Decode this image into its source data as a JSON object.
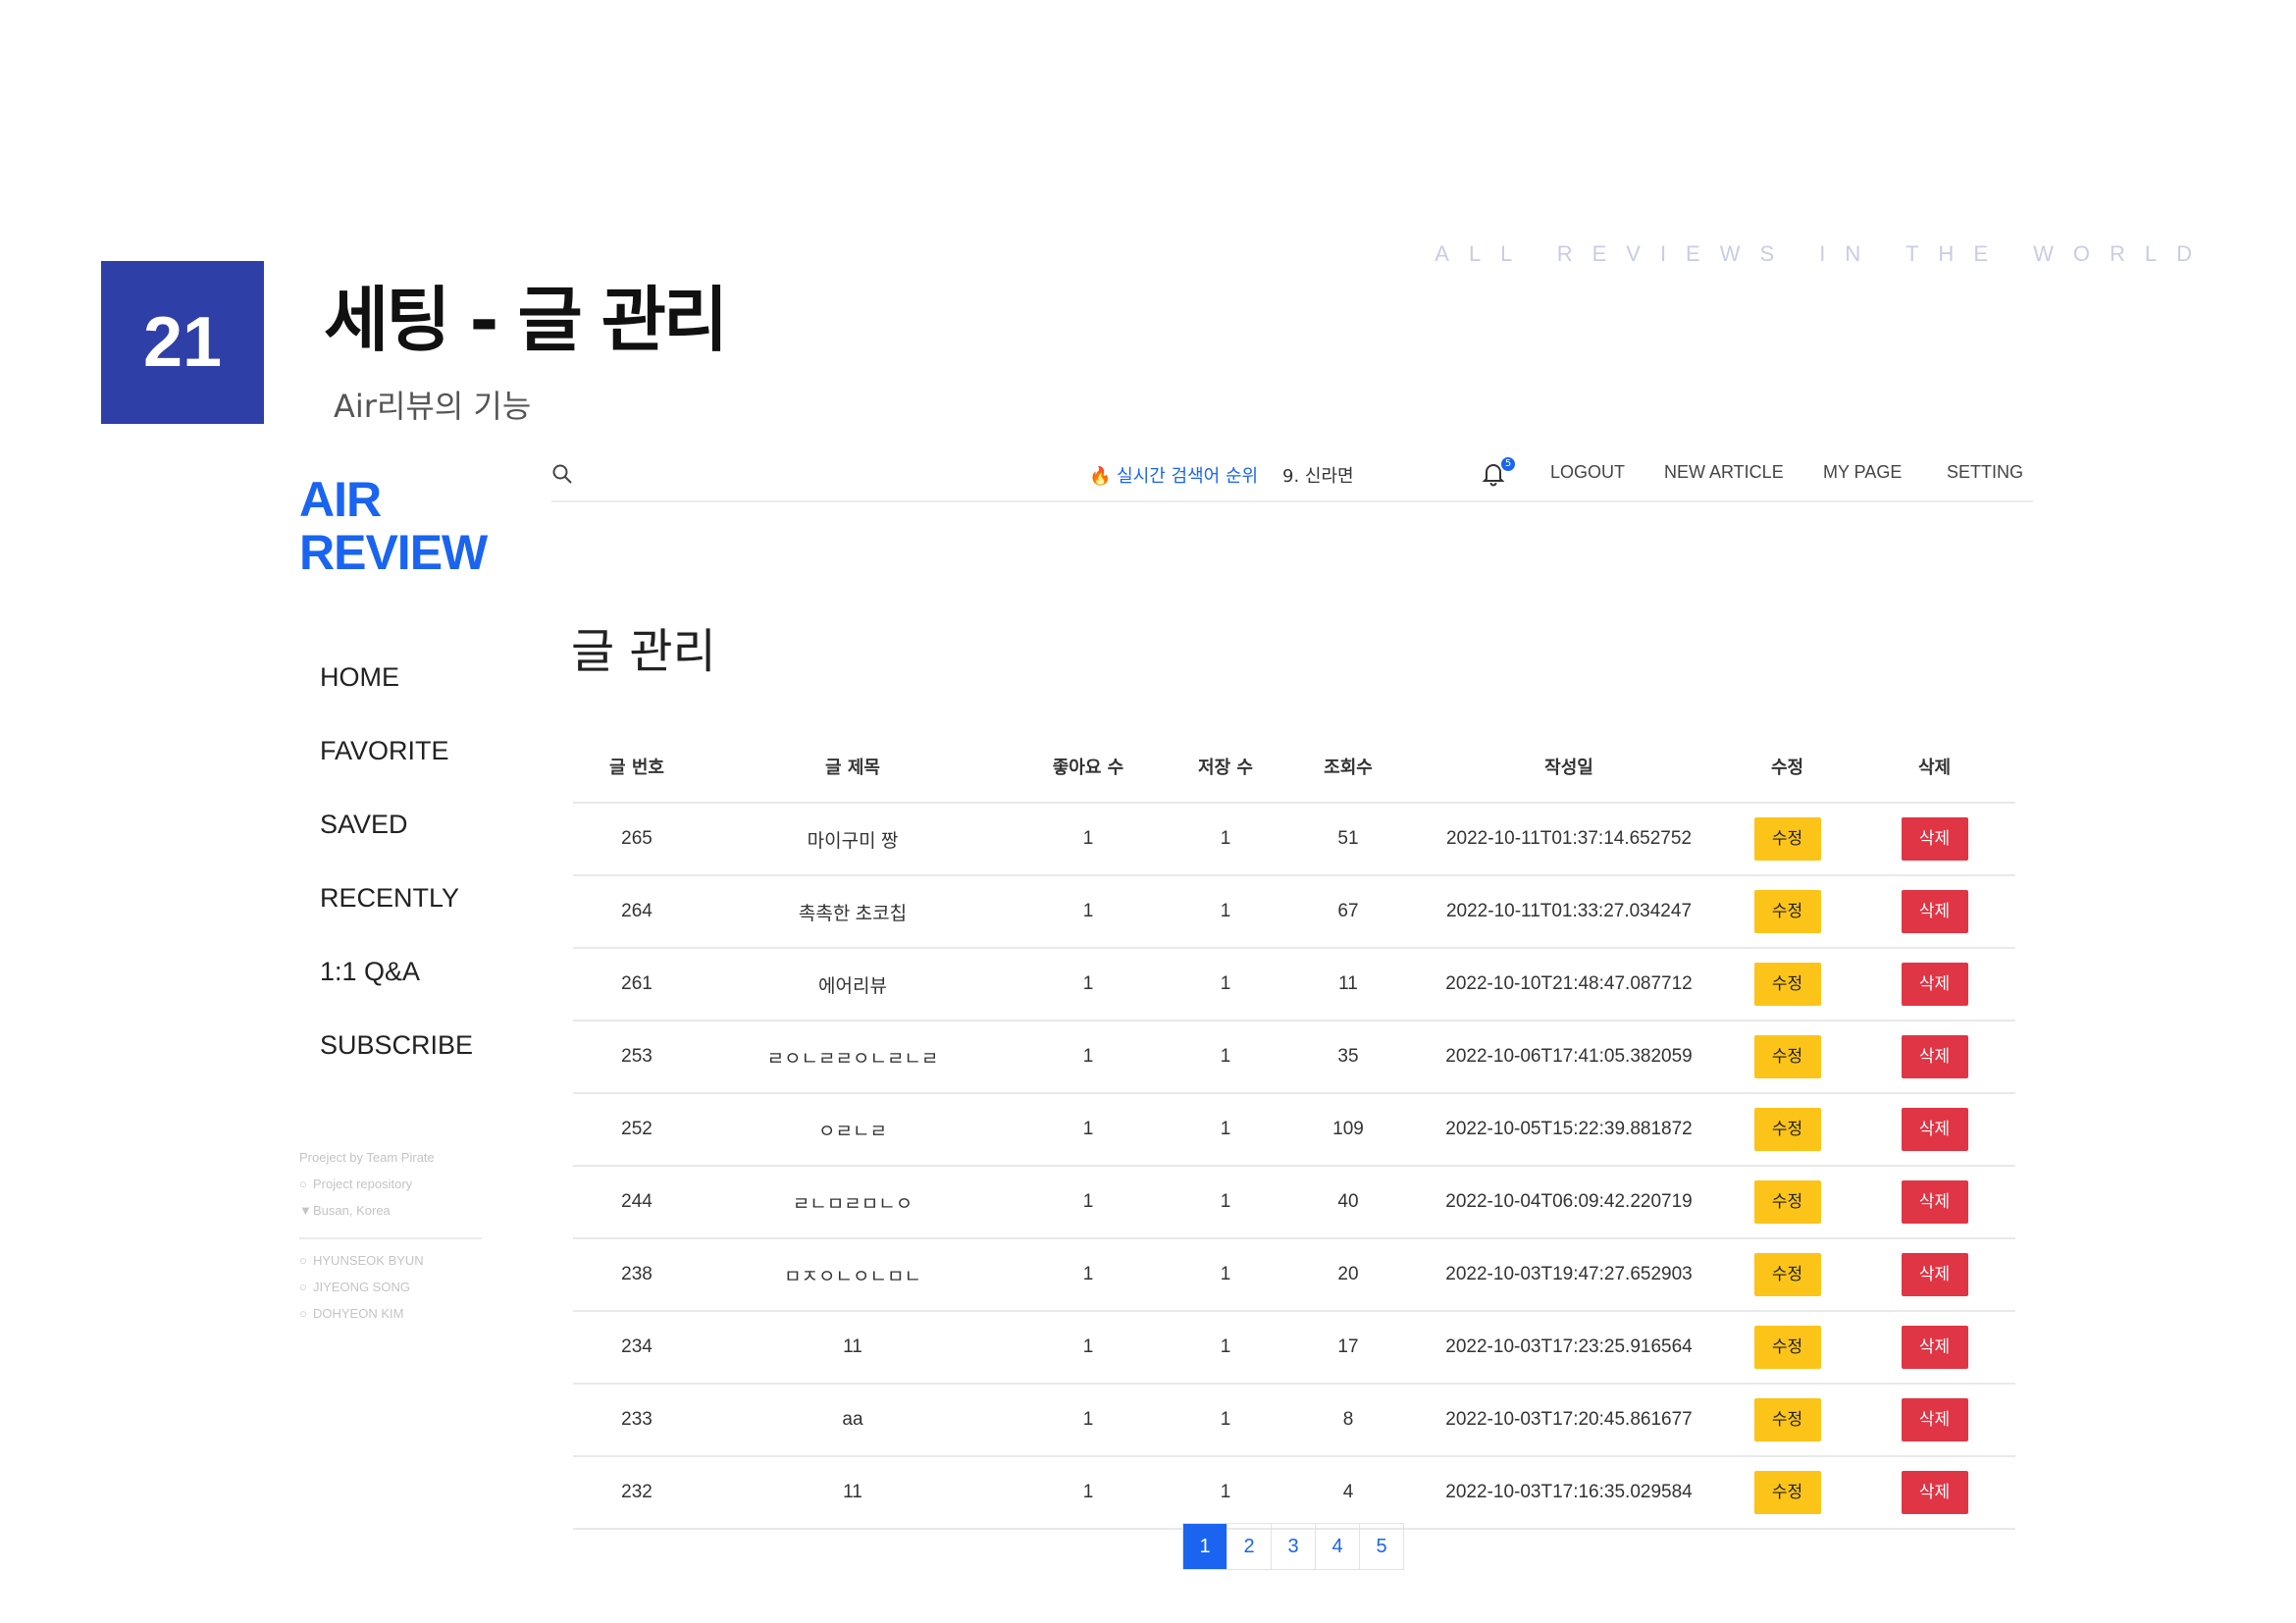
{
  "slide": {
    "number": "21",
    "title": "세팅 - 글 관리",
    "subtitle": "Air리뷰의 기능",
    "tagline": "ALL REVIEWS IN THE WORLD"
  },
  "app": {
    "logo_line1": "AIR",
    "logo_line2": "REVIEW",
    "nav": [
      "HOME",
      "FAVORITE",
      "SAVED",
      "RECENTLY",
      "1:1 Q&A",
      "SUBSCRIBE"
    ],
    "meta": {
      "project_by": "Proeject by Team Pirate",
      "repository": "Project repository",
      "location": "Busan, Korea",
      "members": [
        "HYUNSEOK BYUN",
        "JIYEONG SONG",
        "DOHYEON KIM"
      ]
    },
    "topbar": {
      "trending_label": "실시간 검색어 순위",
      "trending_item": "9. 신라면",
      "notification_count": "5",
      "links": [
        "LOGOUT",
        "NEW ARTICLE",
        "MY PAGE",
        "SETTING"
      ]
    },
    "page_title": "글 관리",
    "table": {
      "headers": [
        "글 번호",
        "글 제목",
        "좋아요 수",
        "저장 수",
        "조회수",
        "작성일",
        "수정",
        "삭제"
      ],
      "edit_label": "수정",
      "delete_label": "삭제",
      "rows": [
        {
          "id": "265",
          "title": "마이구미 짱",
          "likes": "1",
          "saves": "1",
          "views": "51",
          "date": "2022-10-11T01:37:14.652752"
        },
        {
          "id": "264",
          "title": "촉촉한 초코칩",
          "likes": "1",
          "saves": "1",
          "views": "67",
          "date": "2022-10-11T01:33:27.034247"
        },
        {
          "id": "261",
          "title": "에어리뷰",
          "likes": "1",
          "saves": "1",
          "views": "11",
          "date": "2022-10-10T21:48:47.087712"
        },
        {
          "id": "253",
          "title": "ㄹㅇㄴㄹㄹㅇㄴㄹㄴㄹ",
          "likes": "1",
          "saves": "1",
          "views": "35",
          "date": "2022-10-06T17:41:05.382059"
        },
        {
          "id": "252",
          "title": "ㅇㄹㄴㄹ",
          "likes": "1",
          "saves": "1",
          "views": "109",
          "date": "2022-10-05T15:22:39.881872"
        },
        {
          "id": "244",
          "title": "ㄹㄴㅁㄹㅁㄴㅇ",
          "likes": "1",
          "saves": "1",
          "views": "40",
          "date": "2022-10-04T06:09:42.220719"
        },
        {
          "id": "238",
          "title": "ㅁㅈㅇㄴㅇㄴㅁㄴ",
          "likes": "1",
          "saves": "1",
          "views": "20",
          "date": "2022-10-03T19:47:27.652903"
        },
        {
          "id": "234",
          "title": "11",
          "likes": "1",
          "saves": "1",
          "views": "17",
          "date": "2022-10-03T17:23:25.916564"
        },
        {
          "id": "233",
          "title": "aa",
          "likes": "1",
          "saves": "1",
          "views": "8",
          "date": "2022-10-03T17:20:45.861677"
        },
        {
          "id": "232",
          "title": "11",
          "likes": "1",
          "saves": "1",
          "views": "4",
          "date": "2022-10-03T17:16:35.029584"
        }
      ]
    },
    "pagination": {
      "pages": [
        "1",
        "2",
        "3",
        "4",
        "5"
      ],
      "current": "1"
    }
  },
  "colors": {
    "brand": "#1a64f0",
    "slide_badge": "#2e3fa8",
    "edit": "#fcc419",
    "delete": "#e03545"
  }
}
